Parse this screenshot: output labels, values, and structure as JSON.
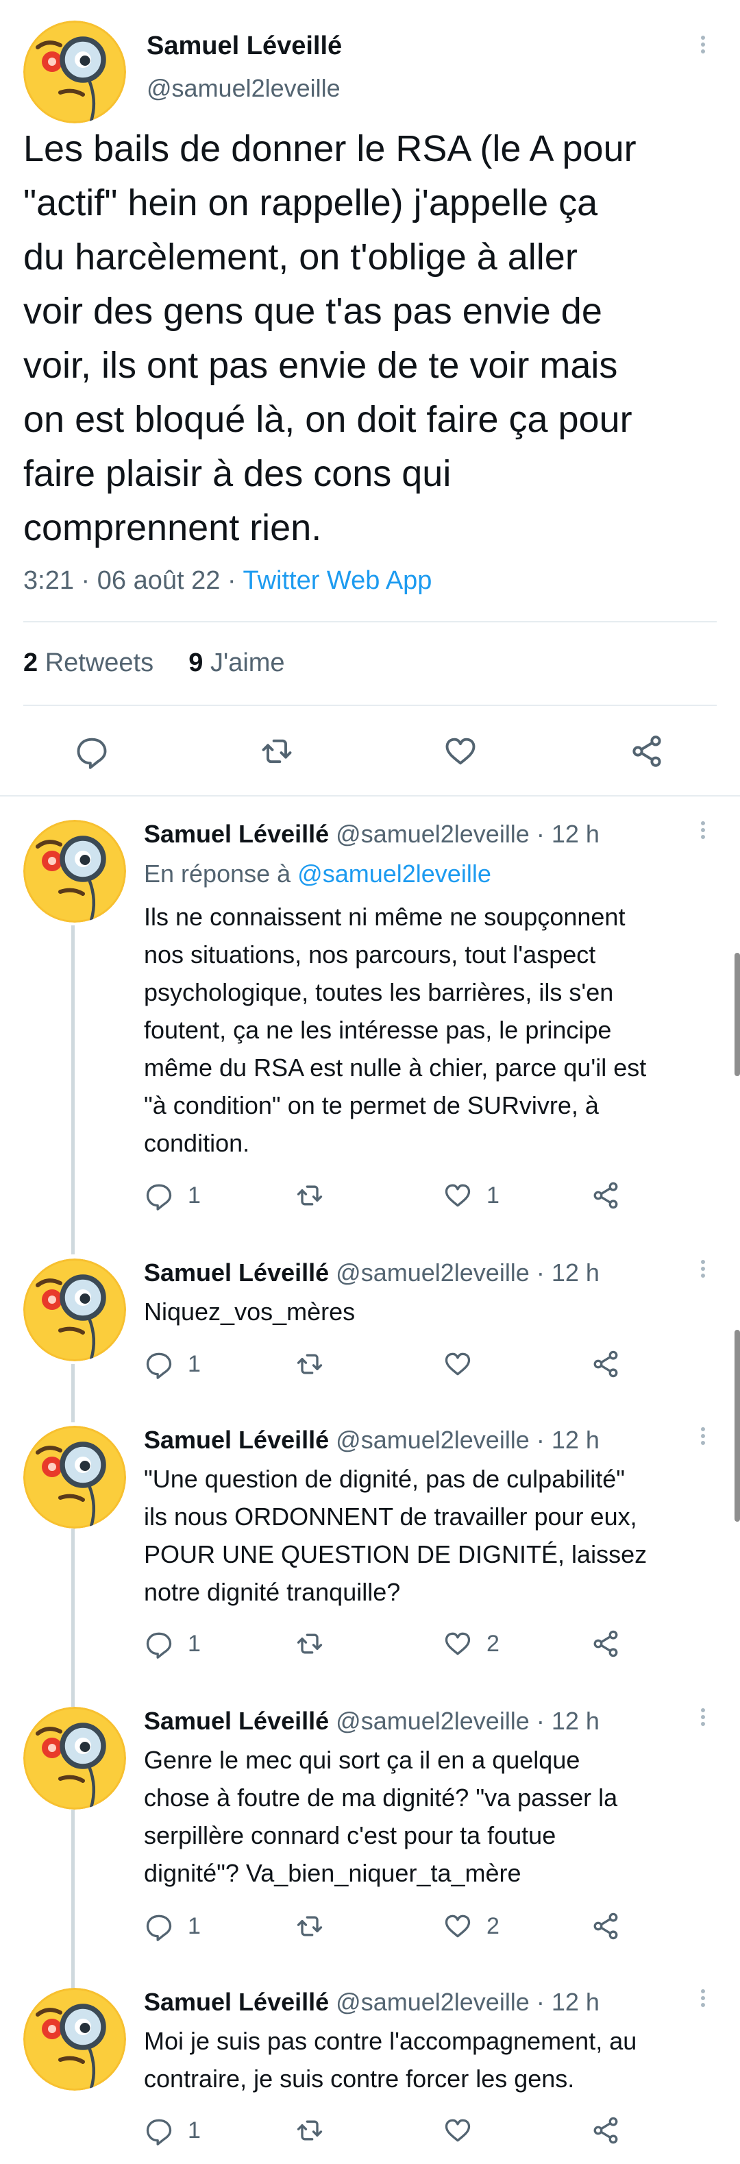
{
  "main_tweet": {
    "author_name": "Samuel Léveillé",
    "author_handle": "@samuel2leveille",
    "text": "Les bails de donner le RSA (le A pour\n\"actif\" hein on rappelle) j'appelle ça\ndu harcèlement, on t'oblige à aller\nvoir des gens que t'as pas envie de\nvoir, ils ont pas envie de te voir mais\non est bloqué là, on doit faire ça pour\nfaire plaisir à des cons qui\ncomprennent rien.",
    "time": "3:21",
    "sep1": "·",
    "date": "06 août 22",
    "sep2": "·",
    "source": "Twitter Web App",
    "retweets_count": "2",
    "retweets_label": "Retweets",
    "likes_count": "9",
    "likes_label": "J'aime"
  },
  "replies": [
    {
      "name": "Samuel Léveillé",
      "handle": "@samuel2leveille",
      "sep": "·",
      "time": "12 h",
      "reply_prefix": "En réponse à",
      "reply_to": "@samuel2leveille",
      "text": "Ils ne connaissent ni même ne soupçonnent\nnos situations, nos parcours, tout l'aspect\npsychologique, toutes les barrières, ils s'en\nfoutent, ça ne les intéresse pas, le principe\nmême du RSA est nulle à chier, parce qu'il est\n\"à condition\" on te permet de SURvivre, à\ncondition.",
      "reply_count": "1",
      "like_count": "1"
    },
    {
      "name": "Samuel Léveillé",
      "handle": "@samuel2leveille",
      "sep": "·",
      "time": "12 h",
      "text": "Niquez_vos_mères",
      "reply_count": "1",
      "like_count": ""
    },
    {
      "name": "Samuel Léveillé",
      "handle": "@samuel2leveille",
      "sep": "·",
      "time": "12 h",
      "text": "\"Une question de dignité, pas de culpabilité\"\nils nous ORDONNENT de travailler pour eux,\nPOUR UNE QUESTION DE DIGNITÉ, laissez\nnotre dignité tranquille?",
      "reply_count": "1",
      "like_count": "2"
    },
    {
      "name": "Samuel Léveillé",
      "handle": "@samuel2leveille",
      "sep": "·",
      "time": "12 h",
      "text": "Genre le mec qui sort ça il en a quelque\nchose à foutre de ma dignité? \"va passer la\nserpillère connard c'est pour ta foutue\ndignité\"? Va_bien_niquer_ta_mère",
      "reply_count": "1",
      "like_count": "2"
    },
    {
      "name": "Samuel Léveillé",
      "handle": "@samuel2leveille",
      "sep": "·",
      "time": "12 h",
      "text": "Moi je suis pas contre l'accompagnement, au\ncontraire, je suis contre forcer les gens.",
      "reply_count": "1",
      "like_count": ""
    }
  ],
  "colors": {
    "link": "#1d9bf0",
    "secondary_text": "#536471",
    "thread_line": "#cfd9de"
  },
  "icons": [
    "more-icon",
    "reply-icon",
    "retweet-icon",
    "like-icon",
    "share-icon",
    "avatar-monocle-emoji"
  ]
}
